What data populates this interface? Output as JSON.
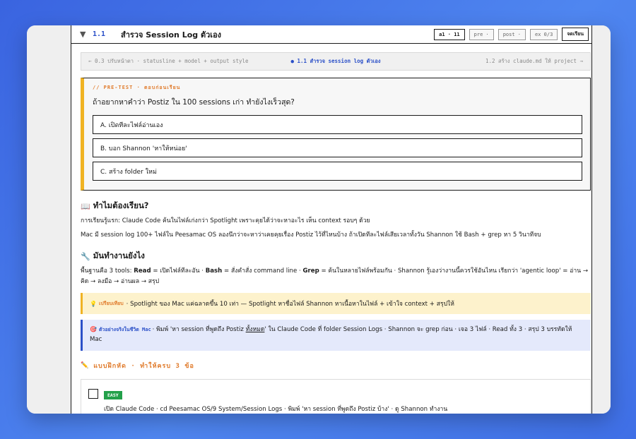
{
  "header": {
    "lesson_number": "1.1",
    "lesson_title": "สำรวจ Session Log ตัวเอง",
    "buttons": [
      "a1 · 11",
      "pre ·",
      "post ·",
      "ex 0/3",
      "จดเรียน"
    ]
  },
  "nav": {
    "prev": "← 0.3 ปรับหน้าตา · statusline + model + output style",
    "current": "● 1.1 สำรวจ session log ตัวเอง",
    "next": "1.2 สร้าง claude.md ให้ project →"
  },
  "pretest": {
    "label": "// PRE-TEST · ตอบก่อนเรียน",
    "question": "ถ้าอยากหาคำว่า Postiz ใน 100 sessions เก่า ทำยังไงเร็วสุด?",
    "options": [
      "A. เปิดทีละไฟล์อ่านเอง",
      "B. บอก Shannon 'หาให้หน่อย'",
      "C. สร้าง folder ใหม่"
    ]
  },
  "why": {
    "icon": "📖",
    "heading": "ทำไมต้องเรียน?",
    "p1": "การเรียนรู้แรก: Claude Code ค้นในไฟล์เก่งกว่า Spotlight เพราะคุยได้ว่าจะหาอะไร เห็น context รอบๆ ด้วย",
    "p2": "Mac มี session log 100+ ไฟล์ใน Peesamac OS ลองนึกว่าจะหาว่าเคยคุยเรื่อง Postiz ไว้ที่ไหนบ้าง ถ้าเปิดทีละไฟล์เสียเวลาทั้งวัน Shannon ใช้ Bash + grep หา 5 วินาทีจบ"
  },
  "how": {
    "icon": "🔧",
    "heading": "มันทำงานยังไง",
    "text_a": "พื้นฐานคือ 3 tools: ",
    "read": "Read",
    "text_b": " = เปิดไฟล์ทีละอัน · ",
    "bash": "Bash",
    "text_c": " = สั่งคำสั่ง command line · ",
    "grep": "Grep",
    "text_d": " = ค้นในหลายไฟล์พร้อมกัน · Shannon รู้เองว่างานนี้ควรใช้อันไหน เรียกว่า 'agentic loop' = อ่าน → คิด → ลงมือ → อ่านผล → สรุป"
  },
  "compare": {
    "icon": "💡",
    "tag": "เปรียบเทียบ",
    "text": "· Spotlight ของ Mac แค่ฉลาดขึ้น 10 เท่า — Spotlight หาชื่อไฟล์ Shannon หาเนื้อหาในไฟล์ + เข้าใจ context + สรุปให้"
  },
  "example": {
    "icon": "🎯",
    "tag": "ตัวอย่างจริงในชีวิต Mac",
    "text_a": "· พิมพ์ 'หา session ที่พูดถึง Postiz ",
    "underline": "ทั้งหมด",
    "text_b": "' ใน Claude Code ที่ folder Session Logs · Shannon จะ grep ก่อน · เจอ 3 ไฟล์ · Read ทั้ง 3 · สรุป 3 บรรทัดให้ Mac"
  },
  "exercises": {
    "icon": "✏️",
    "heading": "แบบฝึกหัด · ทำให้ครบ 3 ข้อ",
    "items": [
      {
        "badge": "EASY",
        "text": "เปิด Claude Code · cd Peesamac OS/9 System/Session Logs · พิมพ์ 'หา session ที่พูดถึง Postiz บ้าง' · ดู Shannon ทำงาน"
      }
    ]
  },
  "colors": {
    "accent_blue": "#2b50c8",
    "accent_orange": "#e07a2a",
    "accent_yellow": "#f0b323",
    "easy_green": "#23a04a"
  }
}
